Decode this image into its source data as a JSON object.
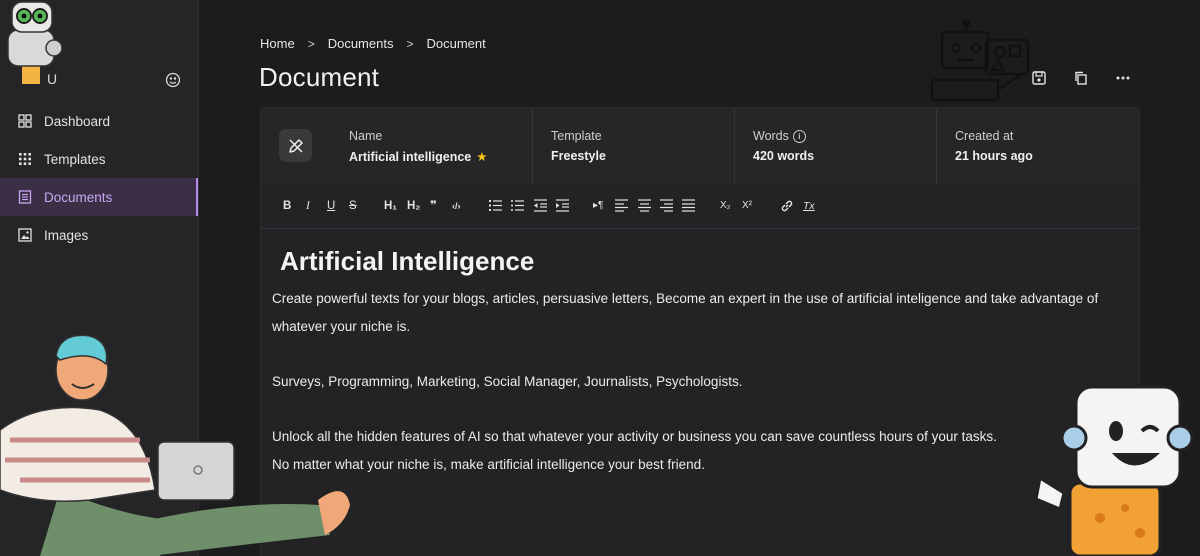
{
  "sidebar": {
    "user_initial": "U",
    "nav": [
      {
        "label": "Dashboard",
        "icon": "grid-icon",
        "active": false
      },
      {
        "label": "Templates",
        "icon": "dots-grid-icon",
        "active": false
      },
      {
        "label": "Documents",
        "icon": "document-icon",
        "active": true
      },
      {
        "label": "Images",
        "icon": "image-icon",
        "active": false
      }
    ]
  },
  "breadcrumb": [
    "Home",
    "Documents",
    "Document"
  ],
  "page_title": "Document",
  "info": {
    "name_label": "Name",
    "name_value": "Artificial intelligence",
    "template_label": "Template",
    "template_value": "Freestyle",
    "words_label": "Words",
    "words_value": "420 words",
    "created_label": "Created at",
    "created_value": "21 hours ago"
  },
  "toolbar": {
    "bold": "B",
    "italic": "I",
    "underline": "U",
    "strike": "S",
    "h1": "H₁",
    "h2": "H₂",
    "quote": "❞",
    "code": "‹/›",
    "sub": "X₂",
    "sup": "X²",
    "clear": "Tx"
  },
  "doc": {
    "heading": "Artificial Intelligence",
    "p1": "Create powerful texts for your blogs, articles, persuasive letters, Become an expert in the use of artificial inteligence and take advantage of whatever your niche is.",
    "p2": "Surveys, Programming, Marketing, Social Manager, Journalists, Psychologists.",
    "p3": "Unlock all the hidden features of AI so that whatever your activity or business you can save countless hours of your tasks.",
    "p4": "No matter what your niche is, make artificial intelligence your best friend."
  },
  "colors": {
    "background": "#1c1c1e",
    "sidebar": "#252527",
    "accent": "#b688ea",
    "active_bg": "#3a2f45",
    "star": "#f5c518"
  }
}
